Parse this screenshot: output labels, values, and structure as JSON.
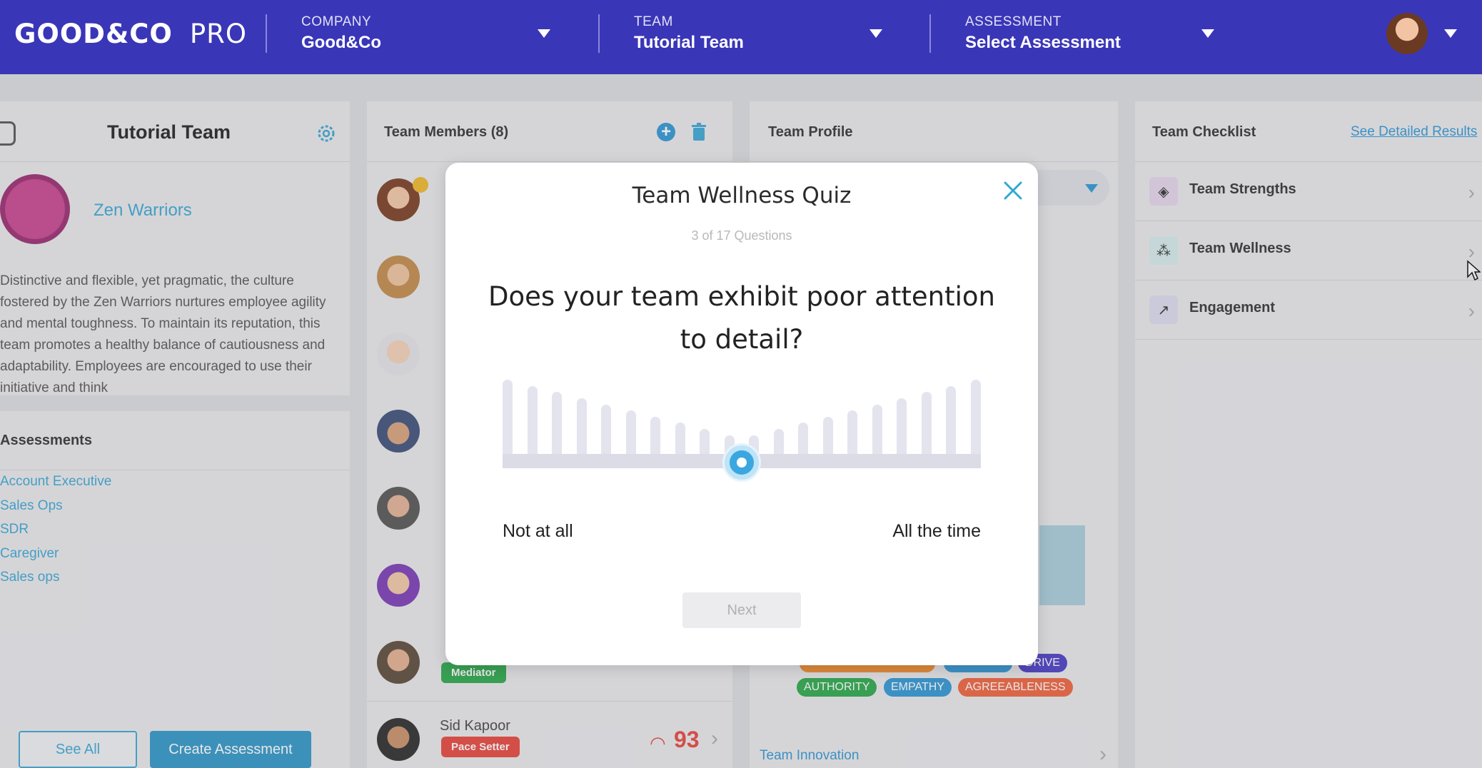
{
  "header": {
    "logo_main": "GOOD&CO",
    "logo_pro": "PRO",
    "company_label": "COMPANY",
    "company_value": "Good&Co",
    "team_label": "TEAM",
    "team_value": "Tutorial Team",
    "assessment_label": "ASSESSMENT",
    "assessment_value": "Select Assessment"
  },
  "left_panel": {
    "title": "Tutorial Team",
    "culture_name": "Zen Warriors",
    "description": "Distinctive and flexible, yet pragmatic, the culture fostered by the Zen Warriors nurtures employee agility and mental toughness. To maintain its reputation, this team promotes a healthy balance of cautiousness and adaptability. Employees are encouraged to use their initiative and think",
    "assessments_heading": "Assessments",
    "assessments": [
      "Account Executive",
      "Sales Ops",
      "SDR",
      "Caregiver",
      "Sales ops"
    ],
    "see_all": "See All",
    "create_assessment": "Create Assessment"
  },
  "members_panel": {
    "heading": "Team Members (8)",
    "badge_mediator": "Mediator",
    "member_name": "Sid Kapoor",
    "member_badge": "Pace Setter",
    "member_score": "93"
  },
  "profile_panel": {
    "heading": "Team Profile",
    "tags": [
      "AUTHORITY",
      "EMPATHY",
      "AGREEABLENESS",
      "DRIVE"
    ],
    "innovation": "Team Innovation"
  },
  "checklist": {
    "heading": "Team Checklist",
    "link": "See Detailed Results",
    "items": [
      {
        "label": "Team Strengths",
        "icon": "diamond-icon"
      },
      {
        "label": "Team Wellness",
        "icon": "network-icon"
      },
      {
        "label": "Engagement",
        "icon": "chart-icon"
      }
    ]
  },
  "modal": {
    "title": "Team Wellness Quiz",
    "progress": "3 of 17 Questions",
    "question": "Does your team exhibit poor attention to detail?",
    "scale_left": "Not at all",
    "scale_right": "All the time",
    "slider_value": 0.5,
    "next": "Next"
  },
  "colors": {
    "topbar": "#3a36b8",
    "accent": "#3aa7d4",
    "score_red": "#e8453c"
  }
}
